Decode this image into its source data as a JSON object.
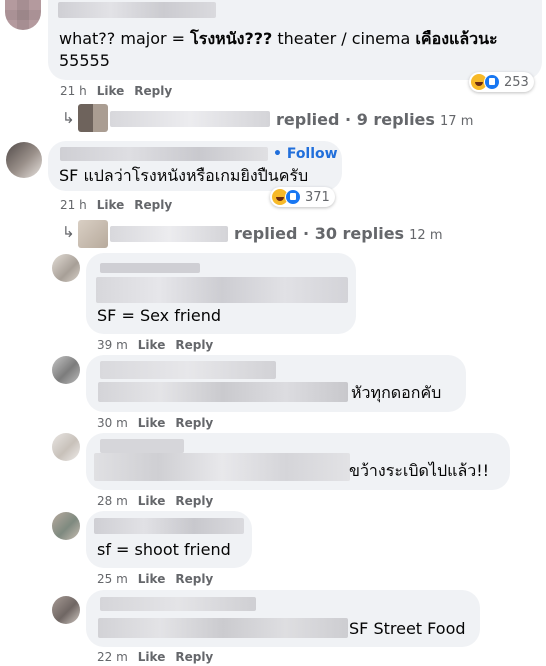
{
  "colors": {
    "bubble": "#f0f2f5",
    "meta_text": "#65676b",
    "follow": "#216fdb"
  },
  "comments": [
    {
      "text_plain": "what?? major = ",
      "text_bold": "โรงหนัง???",
      "text_rest": " theater / cinema ",
      "text_bold2": "เคืองแล้วนะ",
      "text_line2": "55555",
      "time": "21 h",
      "like": "Like",
      "reply": "Reply",
      "reaction_count": "253",
      "reaction_icons": [
        "haha-icon",
        "like-icon"
      ]
    },
    {
      "follow": "• Follow",
      "text": "SF แปลว่าโรงหนังหรือเกมยิงปืนครับ",
      "time": "21 h",
      "like": "Like",
      "reply": "Reply",
      "reaction_count": "371",
      "reaction_icons": [
        "haha-icon",
        "like-icon"
      ]
    }
  ],
  "reply_summaries": [
    {
      "text": "replied · 9 replies",
      "time": "17 m"
    },
    {
      "text": "replied · 30 replies",
      "time": "12 m"
    }
  ],
  "replies": [
    {
      "text": "SF = Sex friend",
      "time": "39 m",
      "like": "Like",
      "reply": "Reply"
    },
    {
      "text": "หัวทุกดอกคับ",
      "time": "30 m",
      "like": "Like",
      "reply": "Reply"
    },
    {
      "text": "ขว้างระเบิดไปแล้ว!!",
      "time": "28 m",
      "like": "Like",
      "reply": "Reply"
    },
    {
      "text": "sf = shoot friend",
      "time": "25 m",
      "like": "Like",
      "reply": "Reply"
    },
    {
      "text": "SF Street Food",
      "time": "22 m",
      "like": "Like",
      "reply": "Reply"
    }
  ]
}
